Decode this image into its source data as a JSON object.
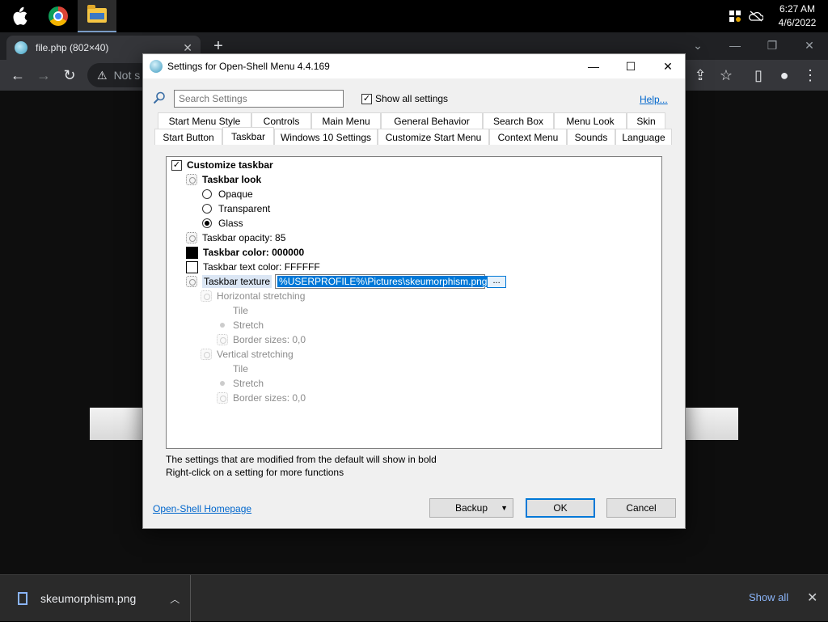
{
  "os_bar": {
    "clock_time": "6:27 AM",
    "clock_date": "4/6/2022"
  },
  "browser": {
    "tab_title": "file.php (802×40)",
    "tab_close": "✕",
    "new_tab": "+",
    "address_text": "Not s"
  },
  "downloads": {
    "file_name": "skeumorphism.png",
    "show_all": "Show all"
  },
  "dialog": {
    "title": "Settings for Open-Shell Menu 4.4.169",
    "search_placeholder": "Search Settings",
    "show_all_label": "Show all settings",
    "show_all_checked": "✓",
    "help_link": "Help...",
    "tabs_row1": [
      "Start Menu Style",
      "Controls",
      "Main Menu",
      "General Behavior",
      "Search Box",
      "Menu Look",
      "Skin"
    ],
    "tabs_row2": [
      "Start Button",
      "Taskbar",
      "Windows 10 Settings",
      "Customize Start Menu",
      "Context Menu",
      "Sounds",
      "Language"
    ],
    "active_tab": "Taskbar",
    "tree": {
      "customize_taskbar": "Customize taskbar",
      "taskbar_look": "Taskbar look",
      "opaque": "Opaque",
      "transparent": "Transparent",
      "glass": "Glass",
      "opacity": "Taskbar opacity: 85",
      "color": "Taskbar color: 000000",
      "text_color": "Taskbar text color: FFFFFF",
      "texture": "Taskbar texture",
      "texture_value": "%USERPROFILE%\\Pictures\\skeumorphism.png",
      "texture_browse": "...",
      "h_stretch": "Horizontal stretching",
      "tile": "Tile",
      "stretch": "Stretch",
      "border_sizes": "Border sizes: 0,0",
      "v_stretch": "Vertical stretching"
    },
    "note_1": "The settings that are modified from the default will show in bold",
    "note_2": "Right-click on a setting for more functions",
    "homepage_link": "Open-Shell Homepage",
    "backup_btn": "Backup",
    "ok_btn": "OK",
    "cancel_btn": "Cancel"
  },
  "colors": {
    "accent": "#0078d7",
    "link": "#0066cc",
    "taskbar_color": "#000000",
    "taskbar_text_color": "#FFFFFF"
  },
  "icons": [
    "apple-icon",
    "chrome-icon",
    "file-explorer-icon",
    "security-icon",
    "network-off-icon",
    "back-icon",
    "forward-icon",
    "reload-icon",
    "warning-icon",
    "share-icon",
    "star-icon",
    "sidebar-icon",
    "profile-icon",
    "menu-icon",
    "search-icon",
    "gear-icon",
    "file-icon"
  ]
}
